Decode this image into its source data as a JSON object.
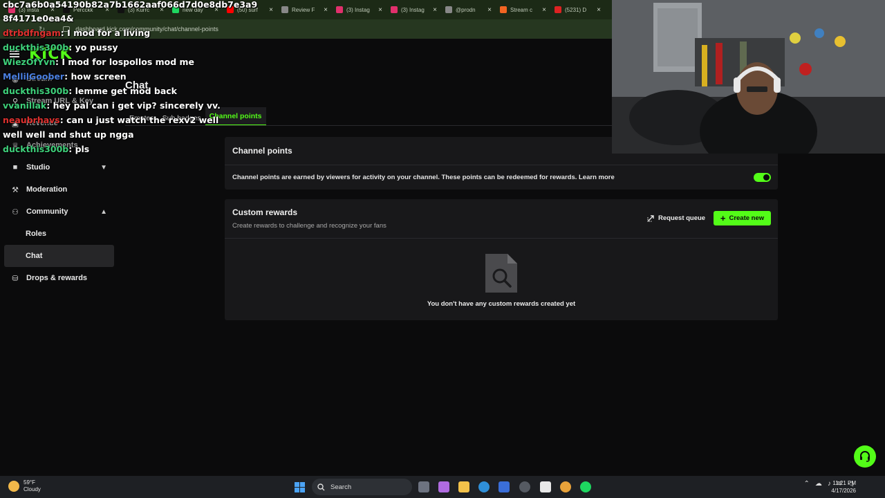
{
  "browser": {
    "tabs": [
      {
        "label": "(3) Insta",
        "color": "#e1306c"
      },
      {
        "label": "Percckk",
        "color": "#111111"
      },
      {
        "label": "(3) Kurrc",
        "color": "#111111"
      },
      {
        "label": "new day",
        "color": "#1ed760"
      },
      {
        "label": "(50) surf",
        "color": "#ff0000"
      },
      {
        "label": "Review F",
        "color": "#888888"
      },
      {
        "label": "(3) Instag",
        "color": "#e1306c"
      },
      {
        "label": "(3) Instag",
        "color": "#e1306c"
      },
      {
        "label": "@prodn",
        "color": "#888888"
      },
      {
        "label": "Stream c",
        "color": "#f26522"
      },
      {
        "label": "(5231) D",
        "color": "#d22"
      }
    ],
    "url": "dashboard.kick.com/community/chat/channel-points"
  },
  "app": {
    "logo": "KICK",
    "accent": "#53fc18"
  },
  "sidebar": {
    "items": [
      {
        "label": "Stream",
        "icon": "broadcast-icon",
        "glyph": "◉"
      },
      {
        "label": "Stream URL & Key",
        "icon": "link-icon",
        "glyph": "⚲"
      },
      {
        "label": "Revenue",
        "icon": "wallet-icon",
        "glyph": "▣"
      },
      {
        "label": "Achievements",
        "icon": "trophy-icon",
        "glyph": "♕"
      },
      {
        "label": "Studio",
        "icon": "video-camera-icon",
        "glyph": "■"
      },
      {
        "label": "Moderation",
        "icon": "hammer-icon",
        "glyph": "⚒"
      },
      {
        "label": "Community",
        "icon": "users-icon",
        "glyph": "⚇"
      },
      {
        "label": "Roles"
      },
      {
        "label": "Chat"
      },
      {
        "label": "Drops & rewards",
        "icon": "gift-icon",
        "glyph": "⛁"
      }
    ]
  },
  "page": {
    "title": "Chat",
    "tabs": [
      "Emotes",
      "Sub badges",
      "Channel points"
    ]
  },
  "channel_points": {
    "title": "Channel points",
    "description": "Channel points are earned by viewers for activity on your channel. These points can be redeemed for rewards. Learn more",
    "enabled": true
  },
  "custom_rewards": {
    "title": "Custom rewards",
    "subtitle": "Create rewards to challenge and recognize your fans",
    "request_queue_label": "Request queue",
    "create_new_label": "Create new",
    "empty_text": "You don't have any custom rewards created yet"
  },
  "chat_overlay": {
    "header": "cbc7a6b0a54190b82a7b1662aaf066d7d0e8db7e3a98f4171e0ea4&",
    "messages": [
      {
        "user": "dtrbdfngam",
        "color": "#e0312f",
        "text": "I mod for a living"
      },
      {
        "user": "duckthis300b",
        "color": "#3ed07a",
        "text": "yo pussy"
      },
      {
        "user": "WiezOfYvn",
        "color": "#3ed07a",
        "text": "I mod for lospollos mod me"
      },
      {
        "user": "MellilGoober",
        "color": "#4a7fe0",
        "text": "how screen"
      },
      {
        "user": "duckthis300b",
        "color": "#3ed07a",
        "text": "lemme get mod back"
      },
      {
        "user": "vvanillak",
        "color": "#3ed07a",
        "text": "hey pal can i get vip? sincerely vv."
      },
      {
        "user": "neaubrhavs",
        "color": "#e0312f",
        "text": "can u just watch the rexv2 well"
      },
      {
        "user": "",
        "color": "#ffffff",
        "text": "well well and shut up ngga"
      },
      {
        "user": "duckthis300b",
        "color": "#3ed07a",
        "text": "pls"
      }
    ]
  },
  "taskbar": {
    "weather_temp": "59°F",
    "weather_desc": "Cloudy",
    "search_label": "Search",
    "time": "11:21 PM",
    "date": "4/17/2026"
  }
}
